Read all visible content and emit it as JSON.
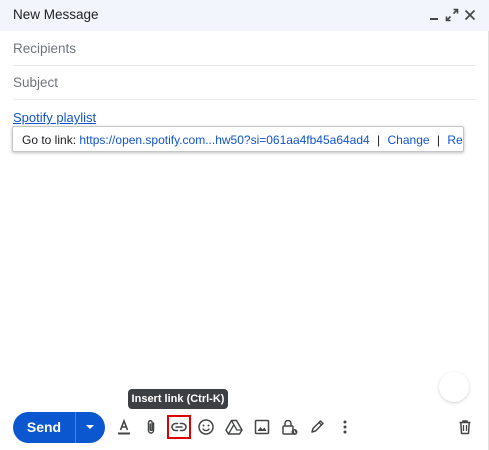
{
  "compose": {
    "title": "New Message",
    "recipients_placeholder": "Recipients",
    "subject_placeholder": "Subject",
    "body_link_text": "Spotify playlist"
  },
  "link_popup": {
    "goto_label": "Go to link:",
    "url": "https://open.spotify.com...hw50?si=061aa4fb45a64ad4",
    "separator": "|",
    "change_label": "Change",
    "remove_label": "Remove"
  },
  "tooltip": {
    "text": "Insert link (Ctrl-K)"
  },
  "toolbar": {
    "send_label": "Send",
    "icons": [
      "format-text-icon",
      "attach-icon",
      "insert-link-icon",
      "emoji-icon",
      "drive-icon",
      "photo-icon",
      "confidential-mode-icon",
      "signature-icon",
      "more-options-icon",
      "delete-icon"
    ]
  },
  "colors": {
    "header_bg": "#f2f6fc",
    "send_button": "#0b57d0",
    "link": "#1155cc",
    "highlight_box": "#e00000",
    "tooltip_bg": "#3c4043"
  }
}
